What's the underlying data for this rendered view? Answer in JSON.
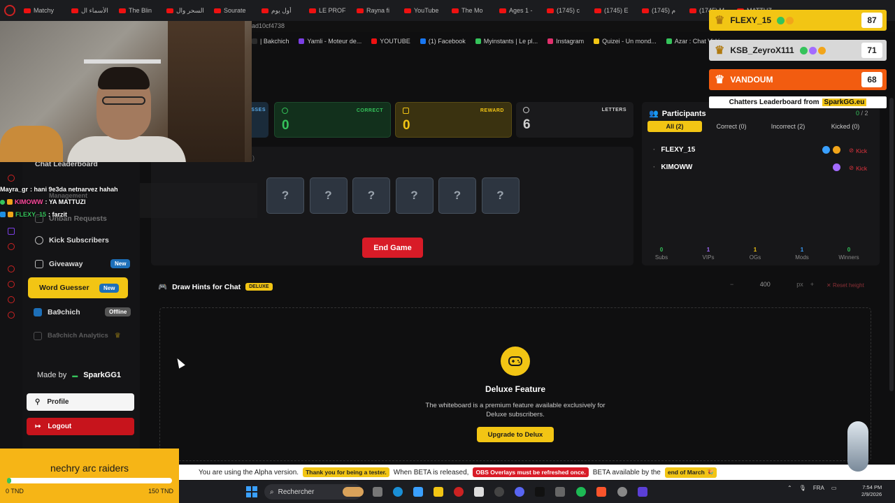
{
  "browser": {
    "tabs": [
      "Matchy",
      "الأسماء ال",
      "The Blin",
      "السحر وال",
      "Sourate",
      "أول يوم",
      "LE PROF",
      "Rayna fi",
      "YouTube",
      "The Mo",
      "Ages 1 -",
      "(1745) c",
      "(1745) E",
      "(1745) م",
      "(1745) M",
      "MATTUZ"
    ],
    "url_fragment": "ad10cf4738",
    "bookmarks": [
      {
        "label": "| Bakchich",
        "color": "#2b2b2b"
      },
      {
        "label": "Yamli - Moteur de...",
        "color": "#7b3fe4"
      },
      {
        "label": "YOUTUBE",
        "color": "#e11"
      },
      {
        "label": "(1) Facebook",
        "color": "#1877f2"
      },
      {
        "label": "Myinstants | Le pl...",
        "color": "#35c35b"
      },
      {
        "label": "Instagram",
        "color": "#e1306c"
      },
      {
        "label": "Quizei - Un mond...",
        "color": "#f2c514"
      },
      {
        "label": "Azar : Chat Vidéo...",
        "color": "#35c35b"
      }
    ]
  },
  "chat_overlay": [
    {
      "user": "Mayra_gr",
      "text": ": hani 9e3da netnarvez hahah",
      "user_color": "#ffffff"
    },
    {
      "user": "KIMOWW",
      "text": ": YA MATTUZI",
      "user_color": "#ff4a9e"
    },
    {
      "user": "FLEXY_15",
      "text": ": farzit",
      "user_color": "#35c35b"
    }
  ],
  "sidebar": {
    "partial_items": [
      "Chat Leaderboard",
      "Management",
      "Unban Requests"
    ],
    "items": [
      {
        "label": "Kick Subscribers",
        "icon": "heart-icon"
      },
      {
        "label": "Giveaway",
        "icon": "gift-icon",
        "badge": "New"
      },
      {
        "label": "Word Guesser",
        "icon": "gamepad-icon",
        "badge": "New",
        "active": true
      },
      {
        "label": "Ba9chich",
        "icon": "ba9chich-icon",
        "badge": "Offline"
      },
      {
        "label": "Ba9chich Analytics",
        "icon": "chart-icon"
      }
    ],
    "made_by_prefix": "Made by",
    "made_by_brand": "SparkGG1",
    "profile_label": "Profile",
    "logout_label": "Logout"
  },
  "goal": {
    "title": "nechry arc raiders",
    "min_label": "0 TND",
    "max_label": "150 TND",
    "progress": 0.0
  },
  "stats": {
    "guesses_label": "GUESSES",
    "correct_label": "CORRECT",
    "correct_value": "0",
    "reward_label": "REWARD",
    "reward_value": "0",
    "letters_label": "LETTERS",
    "letters_value": "6"
  },
  "game": {
    "letter_boxes": [
      "?",
      "?",
      "?",
      "?",
      "?",
      "?"
    ],
    "end_game_label": "End Game",
    "partial_text": ")"
  },
  "participants": {
    "title": "Participants",
    "count_correct": "0",
    "count_total": "2",
    "tabs": [
      "All (2)",
      "Correct (0)",
      "Incorrect (2)",
      "Kicked (0)"
    ],
    "list": [
      {
        "name": "FLEXY_15",
        "kick": "Kick"
      },
      {
        "name": "KIMOWW",
        "kick": "Kick"
      }
    ],
    "stats": [
      {
        "value": "0",
        "label": "Subs",
        "color": "#35c35b"
      },
      {
        "value": "1",
        "label": "VIPs",
        "color": "#a36bff"
      },
      {
        "value": "1",
        "label": "OGs",
        "color": "#f2c514"
      },
      {
        "value": "1",
        "label": "Mods",
        "color": "#3aa0ff"
      },
      {
        "value": "0",
        "label": "Winners",
        "color": "#35c35b"
      }
    ]
  },
  "draw_hints": {
    "title": "Draw Hints for Chat",
    "tag": "DELUXE",
    "height_value": "400",
    "unit": "px",
    "reset_label": "Reset height",
    "feature_title": "Deluxe Feature",
    "feature_desc": "The whiteboard is a premium feature available exclusively for Deluxe subscribers.",
    "upgrade_label": "Upgrade to Delux"
  },
  "leaderboard": {
    "rows": [
      {
        "name": "FLEXY_15",
        "score": "87",
        "bg": "#f2c514",
        "fg": "#1a1a1a"
      },
      {
        "name": "KSB_ZeyroX111",
        "score": "71",
        "bg": "#d8d8d8",
        "fg": "#1a1a1a"
      },
      {
        "name": "VANDOUM",
        "score": "68",
        "bg": "#f25c10",
        "fg": "#ffffff"
      }
    ],
    "footer_prefix": "Chatters Leaderboard from",
    "footer_brand": "SparkGG.eu"
  },
  "alpha_banner": {
    "t1": "You are using the Alpha version.",
    "t2": "Thank you for being a tester.",
    "t3": "When BETA is released,",
    "t4": "OBS Overlays must be refreshed once.",
    "t5": "BETA available by the",
    "t6": "end of March 🎉"
  },
  "taskbar": {
    "search_placeholder": "Rechercher",
    "lang": "FRA",
    "time": "7:54 PM",
    "date": "2/9/2026"
  }
}
